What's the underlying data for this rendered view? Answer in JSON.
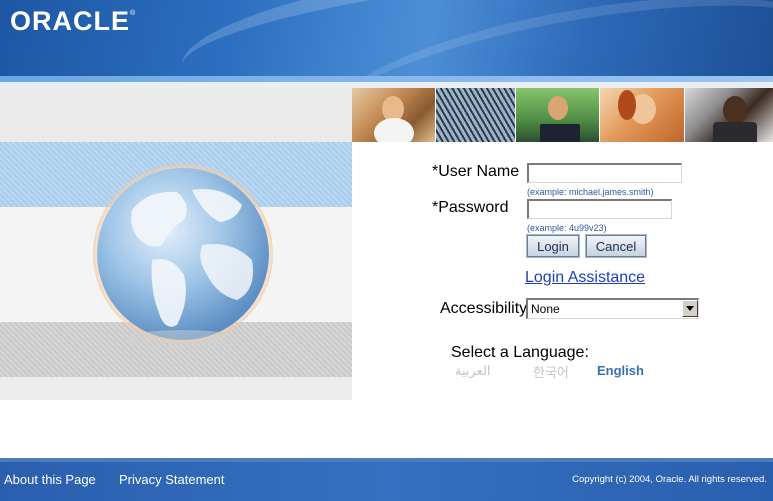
{
  "header": {
    "logo_text": "ORACLE",
    "logo_mark": "®"
  },
  "login": {
    "username_label": "*User Name",
    "username_value": "",
    "username_example": "(example: michael.james.smith)",
    "password_label": "*Password",
    "password_value": "",
    "password_example": "(example: 4u99v23)",
    "login_button": "Login",
    "cancel_button": "Cancel",
    "assistance_link": "Login Assistance"
  },
  "accessibility": {
    "label": "Accessibility",
    "selected": "None"
  },
  "language": {
    "label": "Select a Language:",
    "options": [
      {
        "label": "العربية",
        "state": "faded"
      },
      {
        "label": "한국어",
        "state": "faded"
      },
      {
        "label": "English",
        "state": "current"
      }
    ]
  },
  "footer": {
    "about_link": "About this Page",
    "privacy_link": "Privacy Statement",
    "copyright": "Copyright (c) 2004, Oracle. All rights reserved."
  },
  "colors": {
    "header_blue": "#2c6fc0",
    "footer_blue": "#3470bf",
    "link_blue": "#1d3fbb",
    "english_blue": "#3a6fb0"
  },
  "icons": {
    "globe": "globe-graphic",
    "select_arrow": "chevron-down-icon"
  }
}
